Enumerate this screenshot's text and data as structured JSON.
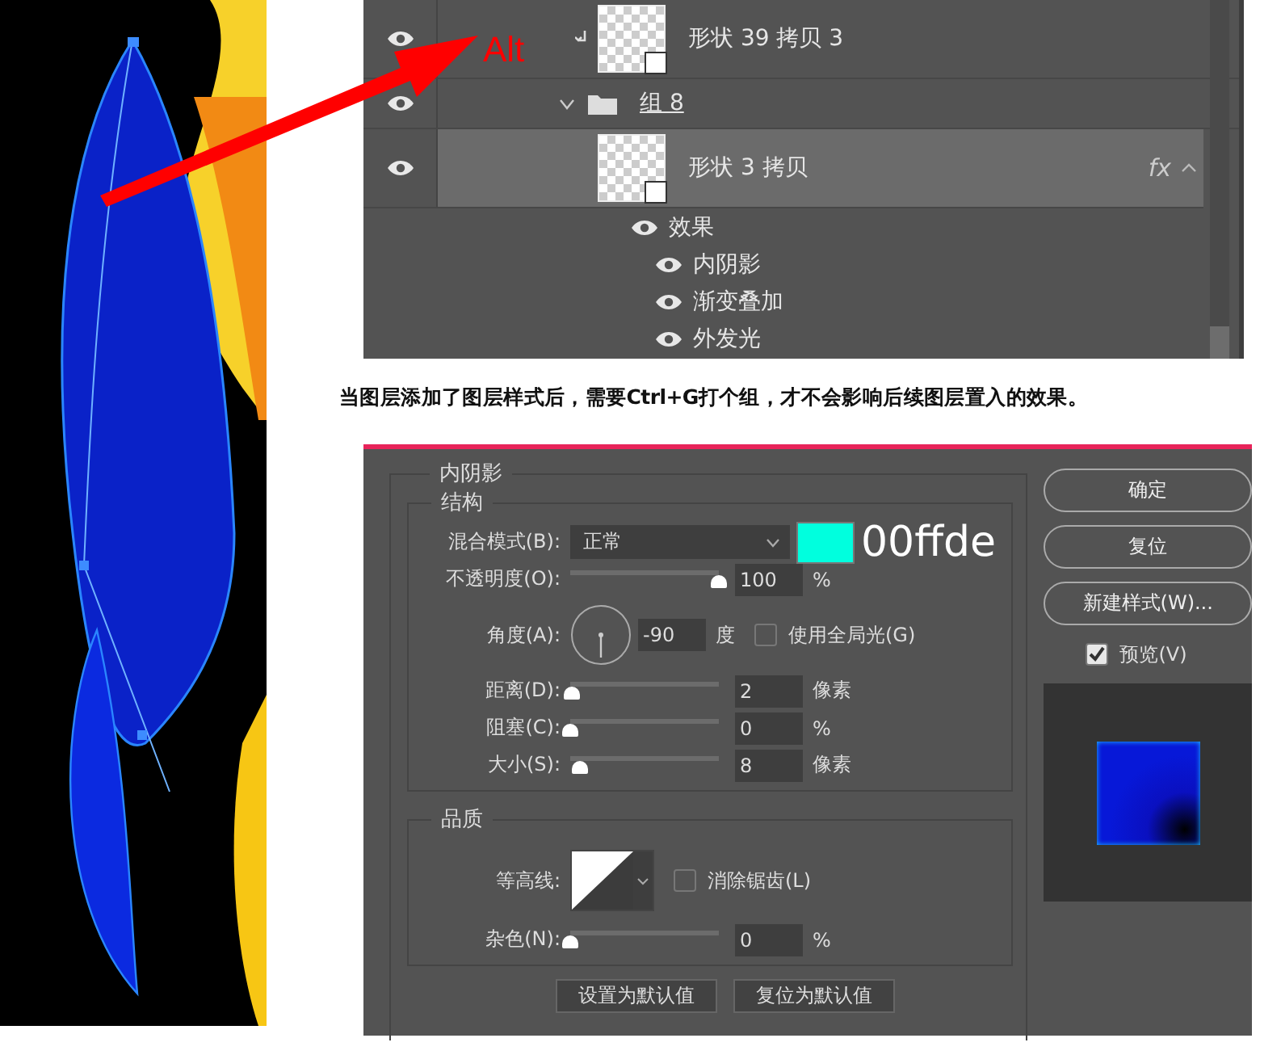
{
  "annotation": {
    "label": "Alt"
  },
  "layers_panel": {
    "layers": [
      {
        "name": "形状 39 拷贝 3",
        "kind": "shape",
        "visible": true,
        "selected": false,
        "clipped": true
      },
      {
        "name": "组 8",
        "kind": "group",
        "visible": true,
        "selected": false,
        "expanded": true
      },
      {
        "name": "形状 3 拷贝",
        "kind": "shape",
        "visible": true,
        "selected": true,
        "clipped": false,
        "fx": "fx"
      }
    ],
    "effects_label": "效果",
    "effects": [
      {
        "name": "内阴影",
        "visible": true
      },
      {
        "name": "渐变叠加",
        "visible": true
      },
      {
        "name": "外发光",
        "visible": true
      }
    ]
  },
  "caption": "当图层添加了图层样式后，需要Ctrl+G打个组，才不会影响后续图层置入的效果。",
  "dialog": {
    "title": "内阴影",
    "structure_title": "结构",
    "blend": {
      "label": "混合模式(B):",
      "value": "正常",
      "color": "#00ffde",
      "color_note": "00ffde"
    },
    "rows": [
      {
        "kind": "slider",
        "label": "不透明度(O):",
        "level": 1,
        "value": "100",
        "unit": "%"
      },
      {
        "kind": "angle",
        "label": "角度(A):",
        "value": "-90",
        "unit": "度",
        "checkbox": {
          "label": "使用全局光(G)",
          "checked": false
        }
      },
      {
        "kind": "slider",
        "label": "距离(D):",
        "level": 0.01,
        "value": "2",
        "unit": "像素"
      },
      {
        "kind": "slider",
        "label": "阻塞(C):",
        "level": 0,
        "value": "0",
        "unit": "%"
      },
      {
        "kind": "slider",
        "label": "大小(S):",
        "level": 0.06,
        "value": "8",
        "unit": "像素"
      }
    ],
    "quality_title": "品质",
    "contour": {
      "label": "等高线:",
      "checkbox": {
        "label": "消除锯齿(L)",
        "checked": false
      }
    },
    "noise": {
      "label": "杂色(N):",
      "level": 0,
      "value": "0",
      "unit": "%"
    },
    "bottom_buttons": [
      "设置为默认值",
      "复位为默认值"
    ],
    "side_buttons": [
      "确定",
      "复位",
      "新建样式(W)..."
    ],
    "preview": {
      "label": "预览(V)",
      "checked": true
    }
  }
}
